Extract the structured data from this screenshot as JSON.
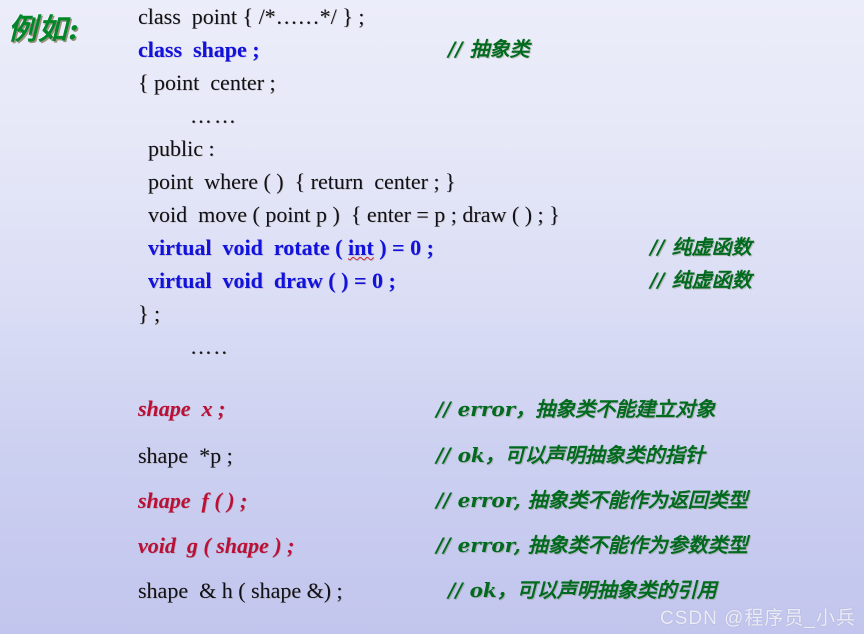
{
  "slide": {
    "example_label": "例如:",
    "background_top": "#ecedfa",
    "background_bottom": "#c2c5ed",
    "keyword_color": "#1212dd",
    "error_color": "#bb0f36",
    "comment_color": "#006b1f",
    "label_color": "#00872a"
  },
  "code_lines": [
    {
      "text": "class  point { /*……*/ } ;",
      "comment": ""
    },
    {
      "text": "class  shape ;",
      "comment": "// 抽象类"
    },
    {
      "text": "{ point  center ;",
      "comment": ""
    },
    {
      "text": "……",
      "comment": ""
    },
    {
      "text": "public :",
      "comment": ""
    },
    {
      "text": "point  where ( )  { return  center ; }",
      "comment": ""
    },
    {
      "text": "void  move ( point p )  { enter = p ; draw ( ) ; }",
      "comment": ""
    },
    {
      "text": "virtual  void  rotate ( int ) = 0 ;",
      "comment": "// 纯虚函数"
    },
    {
      "text": "virtual  void  draw ( ) = 0 ;",
      "comment": "// 纯虚函数"
    },
    {
      "text": "} ;",
      "comment": ""
    },
    {
      "text": "…..",
      "comment": ""
    },
    {
      "text": "shape  x ;",
      "comment": "// error，抽象类不能建立对象"
    },
    {
      "text": "shape  *p ;",
      "comment": "// ok，可以声明抽象类的指针"
    },
    {
      "text": "shape  f ( ) ;",
      "comment": "// error, 抽象类不能作为返回类型"
    },
    {
      "text": "void  g ( shape ) ;",
      "comment": "// error, 抽象类不能作为参数类型"
    },
    {
      "text": "shape  & h ( shape &) ;",
      "comment": "// ok，可以声明抽象类的引用"
    }
  ],
  "code_parts": {
    "l0_a": "class  point { ",
    "l0_b": "/*……*/",
    "l0_c": " } ;",
    "l1": "class  shape ;",
    "l2": "{ point  center ;",
    "l3_dots": "……",
    "l4": "public :",
    "l5": "point  where ( )  { return  center ; }",
    "l6": "void  move ( point p )  { enter = p ; draw ( ) ; }",
    "l7_a": "virtual  void  rotate ( ",
    "l7_int": "int",
    "l7_b": " ) = 0 ;",
    "l8": "virtual  void  draw ( ) = 0 ;",
    "l9": "} ;",
    "l10_dots": "…..",
    "l11": "shape  x ;",
    "l12": "shape  *p ;",
    "l13": "shape  f ( ) ;",
    "l14": "void  g ( shape ) ;",
    "l15": "shape  & h ( shape &) ;"
  },
  "comments": {
    "abstract_class": "// 抽象类",
    "pure_virtual_1": "// 纯虚函数",
    "pure_virtual_2": "// 纯虚函数",
    "err_no_object": "// error，抽象类不能建立对象",
    "ok_pointer": "// ok，可以声明抽象类的指针",
    "err_return_type": "// error, 抽象类不能作为返回类型",
    "err_param_type": "// error, 抽象类不能作为参数类型",
    "ok_reference": "// ok，可以声明抽象类的引用"
  },
  "watermark": {
    "text": "CSDN @程序员_小兵"
  }
}
